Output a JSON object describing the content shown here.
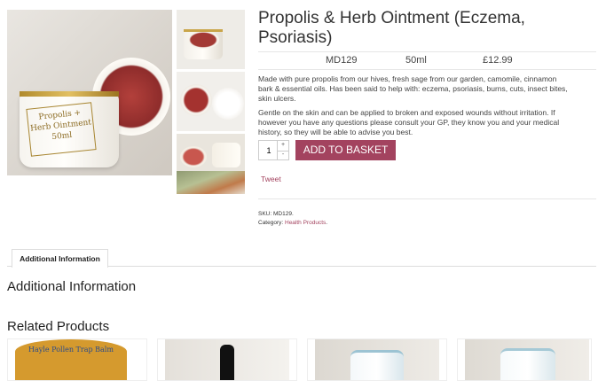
{
  "product": {
    "title": "Propolis & Herb Ointment (Eczema, Psoriasis)",
    "code": "MD129",
    "size": "50ml",
    "price": "£12.99",
    "description_1": "Made with pure propolis from our hives, fresh sage from our garden, camomile, cinnamon bark & essential oils. Has been said to help with: eczema, psoriasis, burns, cuts, insect bites, skin ulcers.",
    "description_2": "Gentle on the skin and can be applied to broken and exposed wounds without irritation. If however you have any questions please consult your GP, they know you and your medical history, so they will be able to advise you best.",
    "quantity": "1",
    "add_to_basket_label": "ADD TO BASKET",
    "tweet_label": "Tweet",
    "sku_label": "SKU:",
    "sku_value": "MD129.",
    "category_label": "Category:",
    "category_value": "Health Products",
    "jar_label": "Propolis + Herb Ointment 50ml"
  },
  "tabs": {
    "active_tab_label": "Additional Information",
    "panel_heading": "Additional Information"
  },
  "related": {
    "heading": "Related Products",
    "card1_label": "Hayle Pollen Trap Balm"
  },
  "colors": {
    "accent": "#a3435f",
    "text": "#333333",
    "border": "#e6e6e6"
  }
}
